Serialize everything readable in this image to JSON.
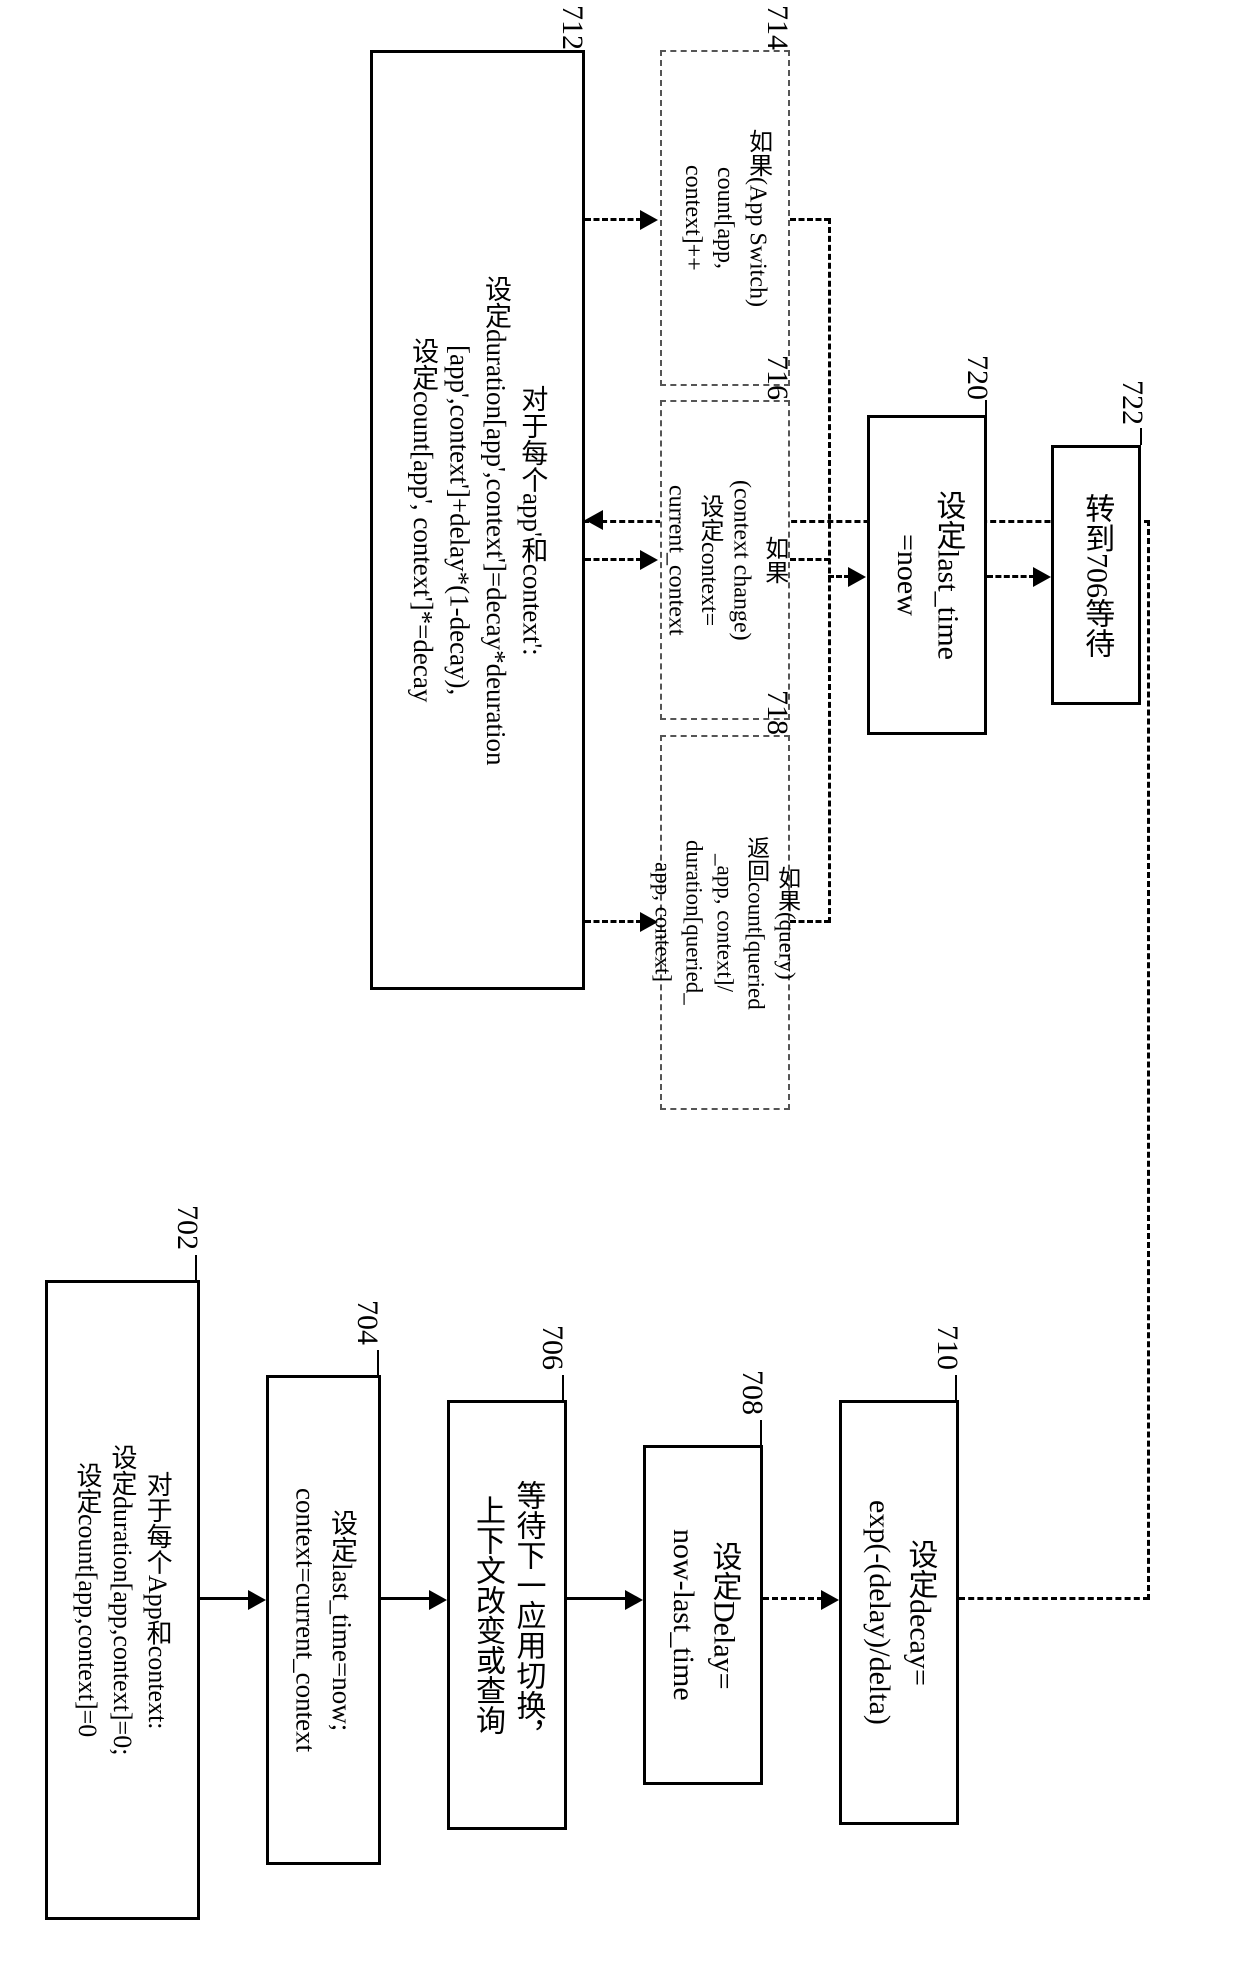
{
  "labels": {
    "b702": "702",
    "b704": "704",
    "b706": "706",
    "b708": "708",
    "b710": "710",
    "b712": "712",
    "b714": "714",
    "b716": "716",
    "b718": "718",
    "b720": "720",
    "b722": "722"
  },
  "boxes": {
    "b702": "对于每个App和context:\n设定duration[app,context]=0;\n设定count[app,context]=0",
    "b704": "设定last_time=now;\ncontext=current_context",
    "b706": "等待下一应用切换，\n上下文改变或查询",
    "b708": "设定Delay=\nnow-last_time",
    "b710": "设定decay=\nexp(-(delay)/delta)",
    "b712": "对于每个app'和context':\n设定duration[app',context']=decay*deuration\n[app',context']+delay*(1-decay),\n设定count[app', context']*=decay",
    "b714": "如果(App Switch)\ncount[app,\ncontext]++",
    "b716": "如果\n(context change)\n设定context=\ncurrent_context",
    "b718": "如果(query)\n返回count[queried\n_app, context]/\nduration[queried_\napp, context]",
    "b720": "设定last_time\n=noew",
    "b722": "转到706等待"
  }
}
